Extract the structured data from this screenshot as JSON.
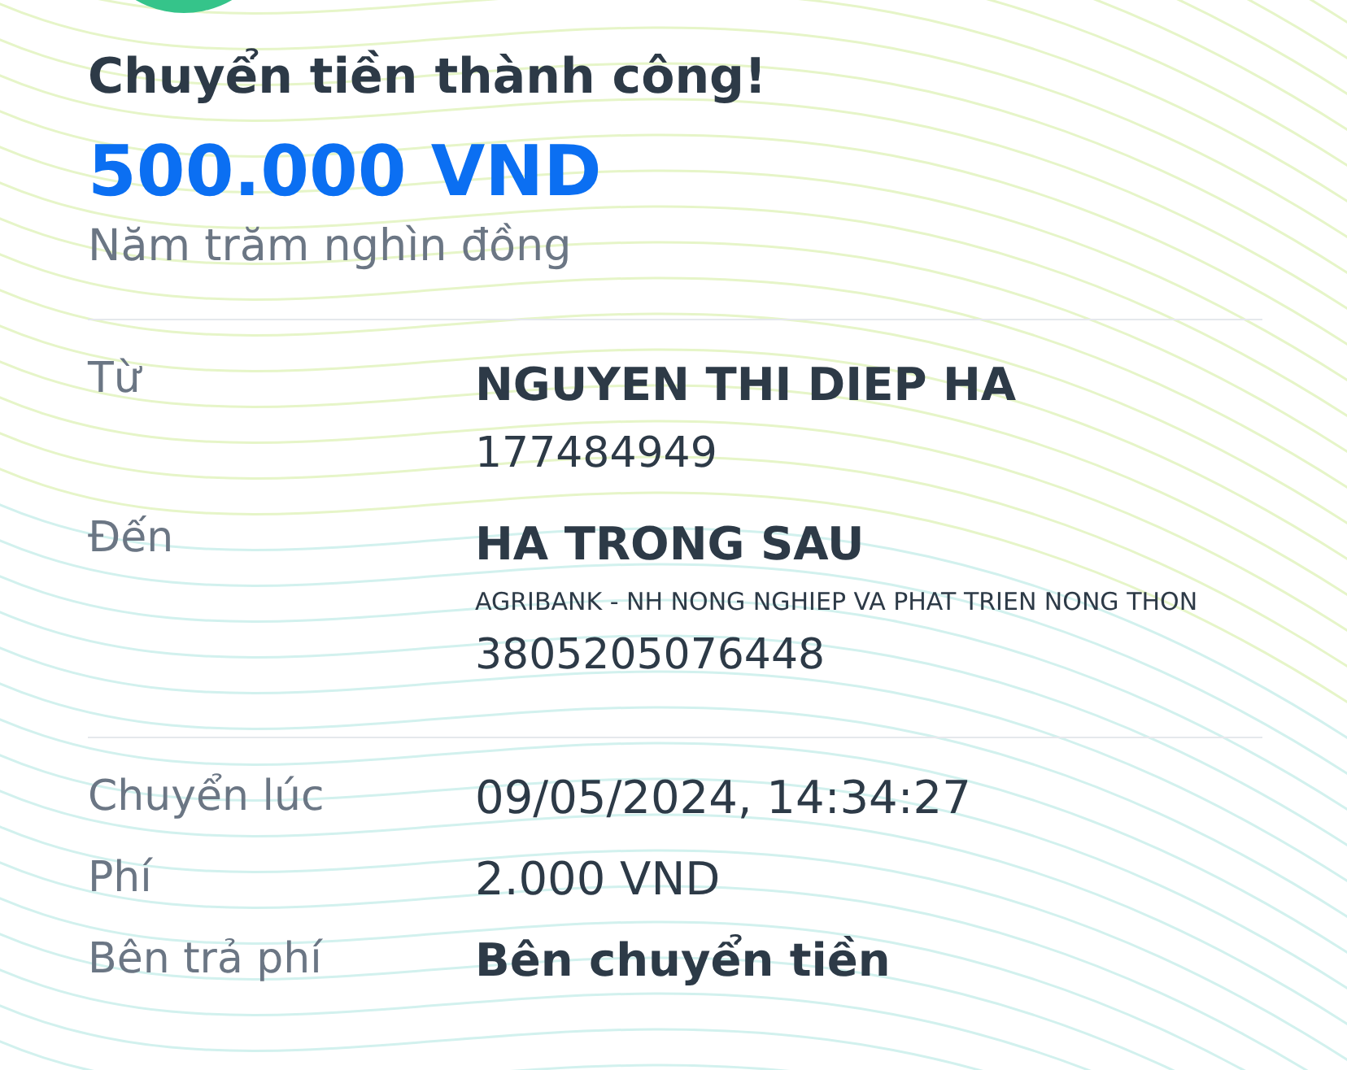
{
  "title": "Chuyển tiền thành công!",
  "amount": "500.000 VND",
  "amount_in_words": "Năm trăm nghìn đồng",
  "parties": [
    {
      "label": "Từ",
      "name": "NGUYEN THI DIEP HA",
      "account": "177484949"
    },
    {
      "label": "Đến",
      "name": "HA TRONG SAU",
      "bank": "AGRIBANK - NH NONG NGHIEP VA PHAT TRIEN NONG THON",
      "account": "3805205076448"
    }
  ],
  "details": [
    {
      "label": "Chuyển lúc",
      "value": "09/05/2024, 14:34:27"
    },
    {
      "label": "Phí",
      "value": "2.000 VND"
    },
    {
      "label": "Bên trả phí",
      "value": "Bên chuyển tiền"
    }
  ]
}
